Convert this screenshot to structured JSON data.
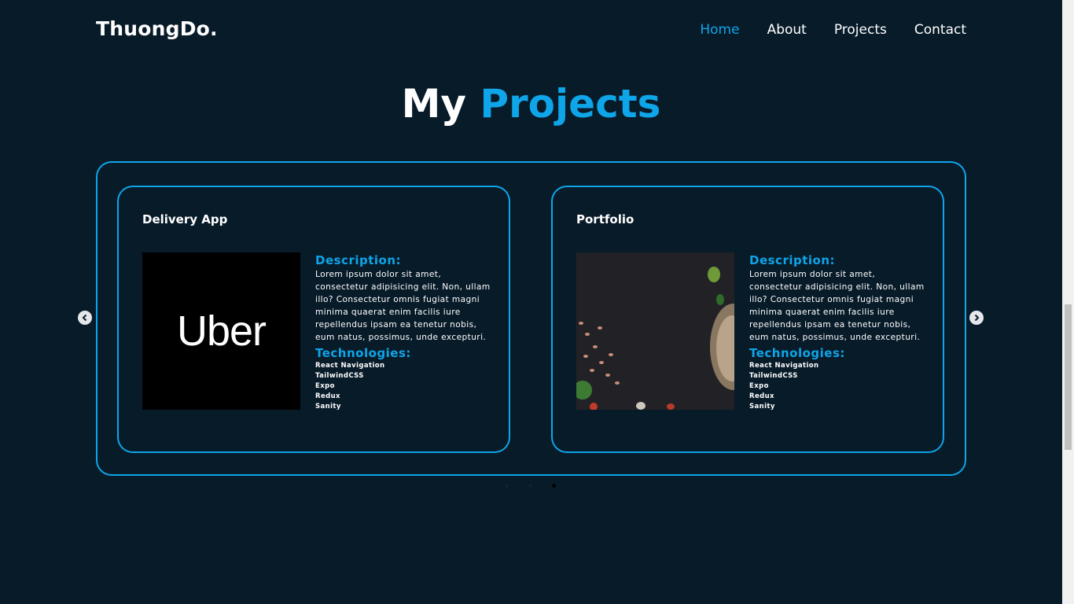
{
  "header": {
    "logo": "ThuongDo.",
    "nav": [
      {
        "label": "Home",
        "active": true
      },
      {
        "label": "About",
        "active": false
      },
      {
        "label": "Projects",
        "active": false
      },
      {
        "label": "Contact",
        "active": false
      }
    ]
  },
  "heading": {
    "prefix": "My",
    "accent": "Projects"
  },
  "projects": [
    {
      "title": "Delivery App",
      "image_text": "Uber",
      "description_label": "Description:",
      "description": "Lorem ipsum dolor sit amet, consectetur adipisicing elit. Non, ullam illo? Consectetur omnis fugiat magni minima quaerat enim facilis iure repellendus ipsam ea tenetur nobis, eum natus, possimus, unde excepturi.",
      "technologies_label": "Technologies:",
      "technologies": [
        "React Navigation",
        "TailwindCSS",
        "Expo",
        "Redux",
        "Sanity"
      ]
    },
    {
      "title": "Portfolio",
      "description_label": "Description:",
      "description": "Lorem ipsum dolor sit amet, consectetur adipisicing elit. Non, ullam illo? Consectetur omnis fugiat magni minima quaerat enim facilis iure repellendus ipsam ea tenetur nobis, eum natus, possimus, unde excepturi.",
      "technologies_label": "Technologies:",
      "technologies": [
        "React Navigation",
        "TailwindCSS",
        "Expo",
        "Redux",
        "Sanity"
      ]
    }
  ],
  "carousel": {
    "active_dot": 3,
    "dot_count": 3
  },
  "colors": {
    "background": "#081b29",
    "accent": "#0ea5e9",
    "text": "#ffffff"
  }
}
